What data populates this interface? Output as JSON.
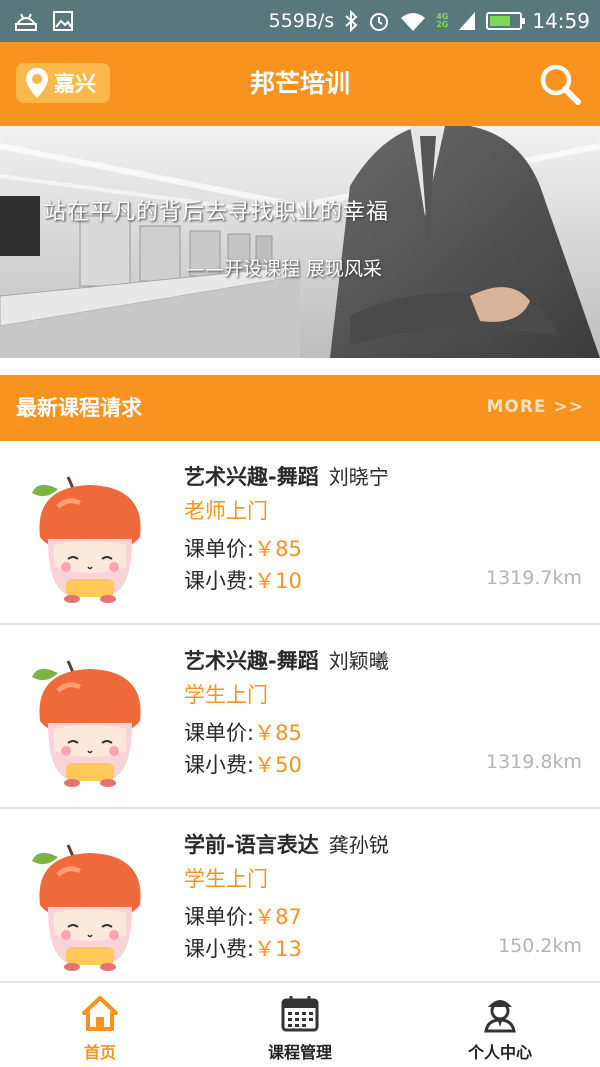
{
  "status_bar": {
    "speed": "559B/s",
    "time": "14:59",
    "net_top": "4G",
    "net_bottom": "2G"
  },
  "header": {
    "location": "嘉兴",
    "title": "邦芒培训",
    "search_icon": "search-icon"
  },
  "banner": {
    "headline": "站在平凡的背后去寻找职业的幸福",
    "tagline": "——开设课程 展现风采"
  },
  "section": {
    "title": "最新课程请求",
    "more_label": "MORE >>"
  },
  "courses": [
    {
      "subject": "艺术兴趣-舞蹈",
      "teacher": "刘晓宁",
      "mode": "老师上门",
      "price_label": "课单价:",
      "price": "￥85",
      "fee_label": "课小费:",
      "fee": "￥10",
      "distance": "1319.7km"
    },
    {
      "subject": "艺术兴趣-舞蹈",
      "teacher": "刘颖曦",
      "mode": "学生上门",
      "price_label": "课单价:",
      "price": "￥85",
      "fee_label": "课小费:",
      "fee": "￥50",
      "distance": "1319.8km"
    },
    {
      "subject": "学前-语言表达",
      "teacher": "龚孙锐",
      "mode": "学生上门",
      "price_label": "课单价:",
      "price": "￥87",
      "fee_label": "课小费:",
      "fee": "￥13",
      "distance": "150.2km"
    }
  ],
  "bottom_nav": [
    {
      "label": "首页",
      "icon": "home-icon",
      "active": true
    },
    {
      "label": "课程管理",
      "icon": "calendar-icon",
      "active": false
    },
    {
      "label": "个人中心",
      "icon": "user-icon",
      "active": false
    }
  ],
  "colors": {
    "accent": "#f7931e",
    "status_bar": "#59787c",
    "distance": "#b3b3b3"
  }
}
